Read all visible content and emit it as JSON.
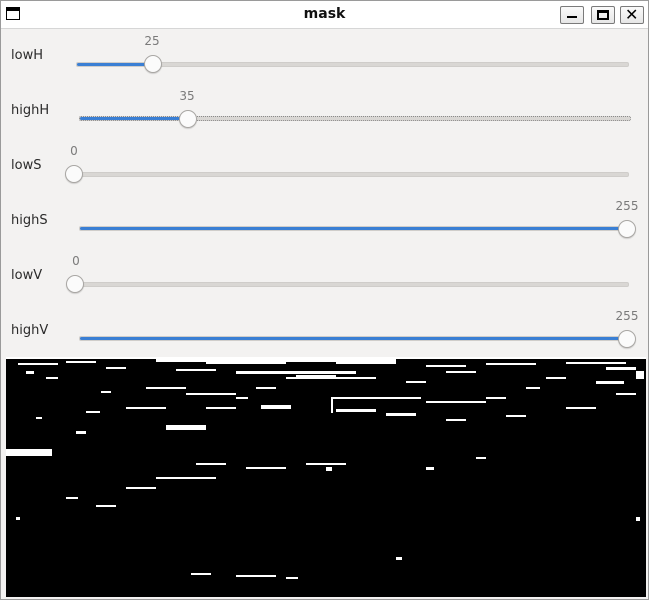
{
  "window": {
    "title": "mask"
  },
  "sliders": [
    {
      "label": "lowH",
      "value": 25,
      "max": 180
    },
    {
      "label": "highH",
      "value": 35,
      "max": 180
    },
    {
      "label": "lowS",
      "value": 0,
      "max": 255
    },
    {
      "label": "highS",
      "value": 255,
      "max": 255
    },
    {
      "label": "lowV",
      "value": 0,
      "max": 255
    },
    {
      "label": "highV",
      "value": 255,
      "max": 255
    }
  ],
  "colors": {
    "accent": "#3a7fd4",
    "mask_bg": "#000000",
    "mask_fg": "#ffffff"
  }
}
